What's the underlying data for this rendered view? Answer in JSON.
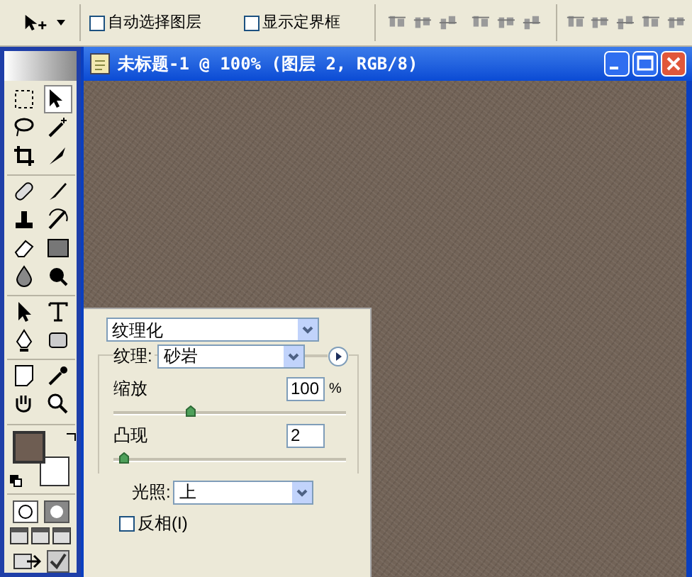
{
  "options_bar": {
    "checkboxes": [
      {
        "label": "自动选择图层",
        "checked": false
      },
      {
        "label": "显示定界框",
        "checked": false
      }
    ]
  },
  "toolbox": {
    "swatches": [
      {
        "kind": "foreground",
        "color": "#6e5d52"
      },
      {
        "kind": "background",
        "color": "#ffffff"
      }
    ]
  },
  "document": {
    "title": "未标题-1 @ 100% (图层 2, RGB/8)"
  },
  "filter_panel": {
    "filter": "纹理化",
    "texture": {
      "label": "纹理:",
      "value": "砂岩"
    },
    "sliders": [
      {
        "label": "缩放",
        "value": "100",
        "unit": "%",
        "level": 0.33
      },
      {
        "label": "凸现",
        "value": "2",
        "level": 0.04
      }
    ],
    "light": {
      "label": "光照:",
      "value": "上"
    },
    "invert": {
      "label": "反相(I)",
      "checked": false
    }
  }
}
